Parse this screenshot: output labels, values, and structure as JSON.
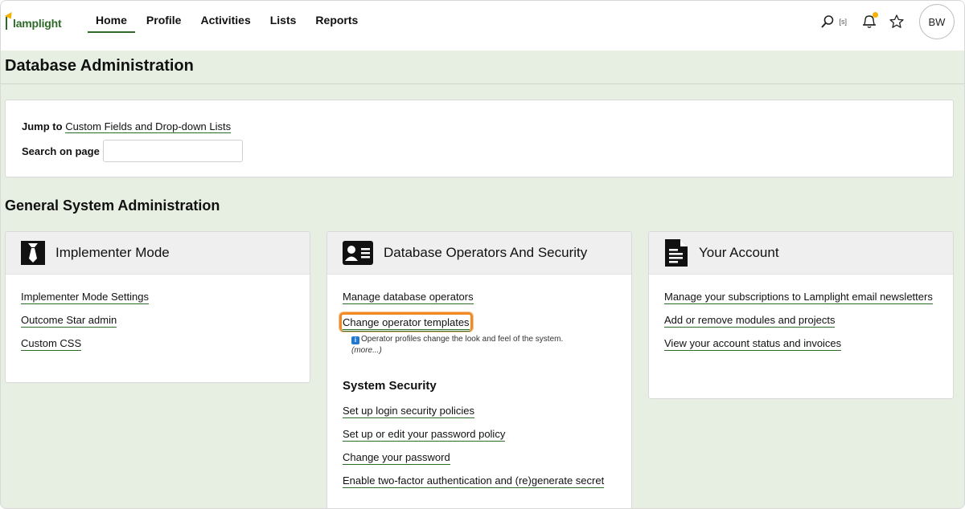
{
  "app": {
    "logo_text": "lamplight"
  },
  "nav": {
    "items": [
      {
        "label": "Home",
        "active": true
      },
      {
        "label": "Profile",
        "active": false
      },
      {
        "label": "Activities",
        "active": false
      },
      {
        "label": "Lists",
        "active": false
      },
      {
        "label": "Reports",
        "active": false
      }
    ],
    "search_shortcut": "[s]",
    "avatar_initials": "BW",
    "icons": [
      "search-icon",
      "bell-icon",
      "star-icon"
    ],
    "notification_dot_color": "#f5b000"
  },
  "page": {
    "title": "Database Administration",
    "jump_label": "Jump to",
    "jump_link": "Custom Fields and Drop-down Lists",
    "search_label": "Search on page",
    "search_value": ""
  },
  "section": {
    "title": "General System Administration"
  },
  "cards": {
    "implementer": {
      "title": "Implementer Mode",
      "icon": "tie-icon",
      "links": [
        "Implementer Mode Settings",
        "Outcome Star admin",
        "Custom CSS"
      ]
    },
    "operators": {
      "title": "Database Operators And Security",
      "icon": "id-card-icon",
      "links": [
        "Manage database operators",
        "Change operator templates"
      ],
      "info_text": "Operator profiles change the look and feel of the system.",
      "info_more": "(more...)",
      "security_heading": "System Security",
      "security_links": [
        "Set up login security policies",
        "Set up or edit your password policy",
        "Change your password",
        "Enable two-factor authentication and (re)generate secret"
      ]
    },
    "account": {
      "title": "Your Account",
      "icon": "document-icon",
      "links": [
        "Manage your subscriptions to Lamplight email newsletters",
        "Add or remove modules and projects",
        "View your account status and invoices"
      ]
    }
  },
  "colors": {
    "accent": "#2f6b28",
    "page_bg": "#e7efe3",
    "highlight": "#f08a24"
  }
}
